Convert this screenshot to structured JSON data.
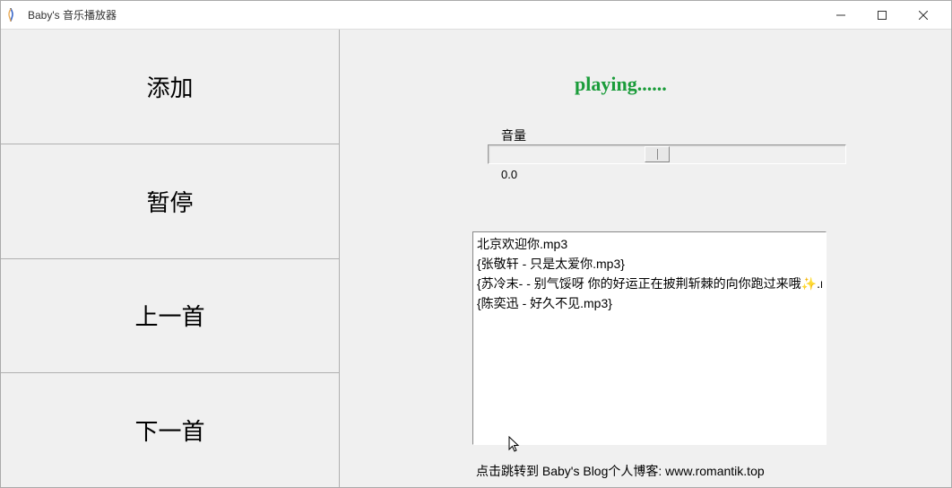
{
  "title": "Baby's 音乐播放器",
  "window_controls": {
    "minimize": "—",
    "maximize": "☐",
    "close": "✕"
  },
  "buttons": {
    "add": "添加",
    "pause": "暂停",
    "prev": "上一首",
    "next": "下一首"
  },
  "status": "playing......",
  "volume": {
    "label": "音量",
    "value_text": "0.0"
  },
  "playlist": [
    "北京欢迎你.mp3",
    "{张敬轩 - 只是太爱你.mp3}",
    "{苏冷末- - 别气馁呀 你的好运正在披荆斩棘的向你跑过来哦✨.m|",
    "{陈奕迅 - 好久不见.mp3}"
  ],
  "blog_text": "点击跳转到 Baby's Blog个人博客:   www.romantik.top"
}
